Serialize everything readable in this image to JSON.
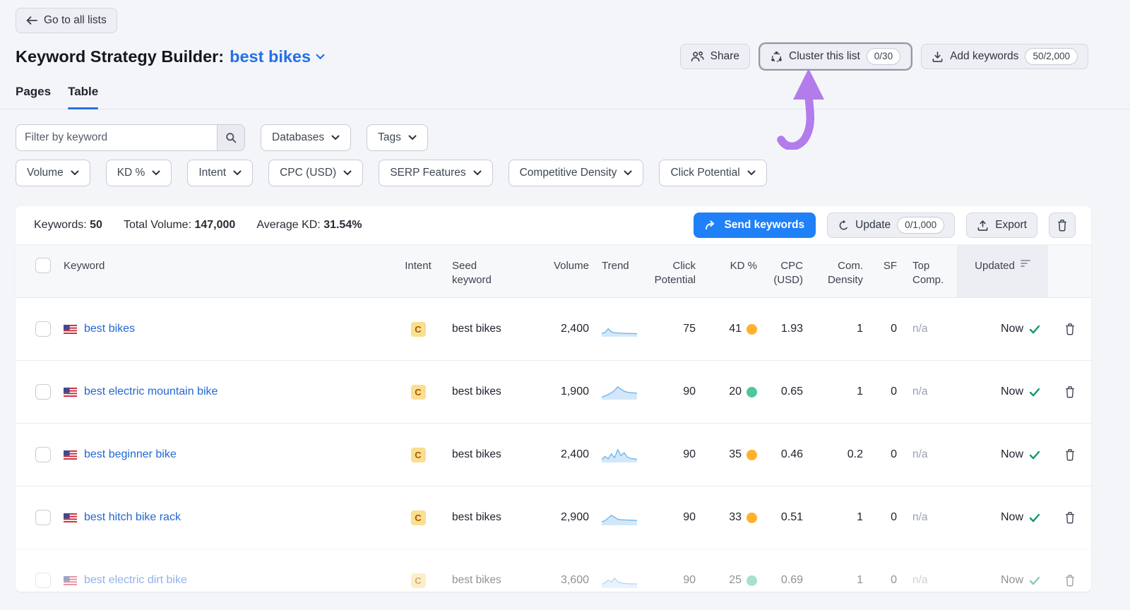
{
  "colors": {
    "page-bg": "#f4f5f9",
    "accent-blue": "#2370e8",
    "primary-button": "#1f80f8",
    "link-blue": "#2268d1",
    "kd-amber": "#ffb12b",
    "kd-green": "#4ec79b",
    "check-green": "#169a62",
    "arrow-purple": "#b27ceb",
    "intent-bg": "#fadf8f",
    "intent-text": "#a75800"
  },
  "header": {
    "back_label": "Go to all lists",
    "title": "Keyword Strategy Builder:",
    "list_name": "best bikes",
    "share_label": "Share",
    "cluster_label": "Cluster this list",
    "cluster_badge": "0/30",
    "add_keywords_label": "Add keywords",
    "add_keywords_badge": "50/2,000"
  },
  "tabs": [
    {
      "label": "Pages",
      "active": false
    },
    {
      "label": "Table",
      "active": true
    }
  ],
  "filters": {
    "search_placeholder": "Filter by keyword",
    "row1": [
      "Databases",
      "Tags"
    ],
    "row2": [
      "Volume",
      "KD %",
      "Intent",
      "CPC (USD)",
      "SERP Features",
      "Competitive Density",
      "Click Potential"
    ]
  },
  "summary": {
    "keywords_label": "Keywords:",
    "keywords_value": "50",
    "volume_label": "Total Volume:",
    "volume_value": "147,000",
    "kd_label": "Average KD:",
    "kd_value": "31.54%",
    "send_label": "Send keywords",
    "update_label": "Update",
    "update_badge": "0/1,000",
    "export_label": "Export"
  },
  "table": {
    "columns": {
      "keyword": "Keyword",
      "intent": "Intent",
      "seed": "Seed keyword",
      "volume": "Volume",
      "trend": "Trend",
      "click_potential": "Click Potential",
      "kd": "KD %",
      "cpc": "CPC (USD)",
      "com_density": "Com. Density",
      "sf": "SF",
      "top_comp": "Top Comp.",
      "updated": "Updated"
    },
    "rows": [
      {
        "keyword": "best bikes",
        "intent": "C",
        "seed": "best bikes",
        "volume": "2,400",
        "trend": [
          18,
          22,
          55,
          30,
          22,
          20,
          18,
          17,
          16,
          15,
          15,
          14
        ],
        "click_potential": "75",
        "kd": "41",
        "kd_color": "kd-amber",
        "cpc": "1.93",
        "com_density": "1",
        "sf": "0",
        "top_comp": "n/a",
        "updated": "Now",
        "faded": false
      },
      {
        "keyword": "best electric mountain bike",
        "intent": "C",
        "seed": "best bikes",
        "volume": "1,900",
        "trend": [
          10,
          18,
          30,
          45,
          65,
          95,
          75,
          58,
          50,
          46,
          44,
          42
        ],
        "click_potential": "90",
        "kd": "20",
        "kd_color": "kd-green",
        "cpc": "0.65",
        "com_density": "1",
        "sf": "0",
        "top_comp": "n/a",
        "updated": "Now",
        "faded": false
      },
      {
        "keyword": "best beginner bike",
        "intent": "C",
        "seed": "best bikes",
        "volume": "2,400",
        "trend": [
          12,
          38,
          18,
          60,
          28,
          95,
          45,
          70,
          32,
          22,
          18,
          14
        ],
        "click_potential": "90",
        "kd": "35",
        "kd_color": "kd-amber",
        "cpc": "0.46",
        "com_density": "0.2",
        "sf": "0",
        "top_comp": "n/a",
        "updated": "Now",
        "faded": false
      },
      {
        "keyword": "best hitch bike rack",
        "intent": "C",
        "seed": "best bikes",
        "volume": "2,900",
        "trend": [
          18,
          26,
          48,
          72,
          55,
          38,
          34,
          33,
          32,
          31,
          30,
          28
        ],
        "click_potential": "90",
        "kd": "33",
        "kd_color": "kd-amber",
        "cpc": "0.51",
        "com_density": "1",
        "sf": "0",
        "top_comp": "n/a",
        "updated": "Now",
        "faded": false
      },
      {
        "keyword": "best electric dirt bike",
        "intent": "C",
        "seed": "best bikes",
        "volume": "3,600",
        "trend": [
          22,
          30,
          55,
          38,
          72,
          42,
          32,
          28,
          26,
          25,
          24,
          23
        ],
        "click_potential": "90",
        "kd": "25",
        "kd_color": "kd-green",
        "cpc": "0.69",
        "com_density": "1",
        "sf": "0",
        "top_comp": "n/a",
        "updated": "Now",
        "faded": true
      }
    ]
  }
}
